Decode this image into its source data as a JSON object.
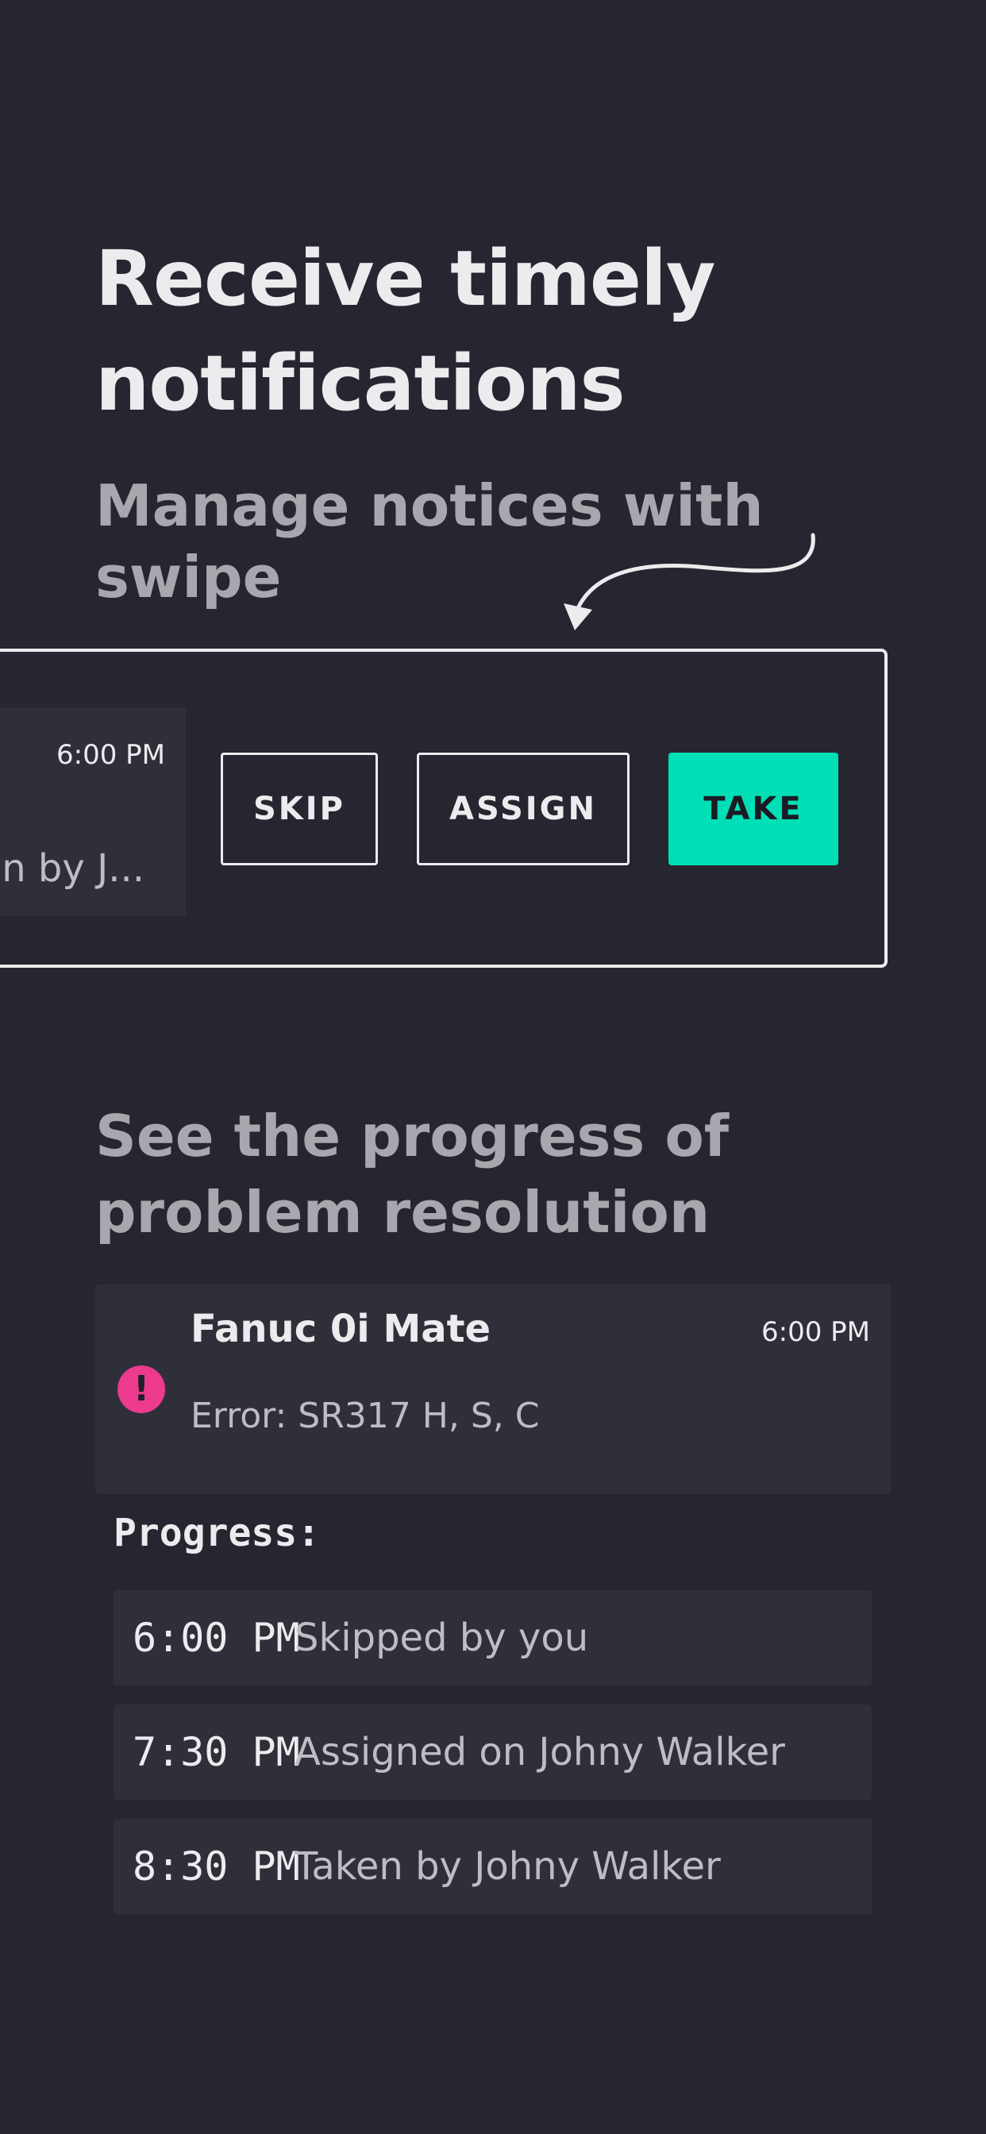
{
  "onboarding": {
    "headline": "Receive timely notifications",
    "subline": "Manage notices with swipe"
  },
  "swipe_demo": {
    "notice_time": "6:00 PM",
    "notice_text": "en by J...",
    "actions": {
      "skip": "SKIP",
      "assign": "ASSIGN",
      "take": "TAKE"
    },
    "take_color": "#00dfb5"
  },
  "progress_section": {
    "title": "See the progress of problem resolution",
    "incident": {
      "icon": "alert-icon",
      "icon_glyph": "!",
      "icon_color": "#ec3a8f",
      "title": "Fanuc 0i Mate",
      "time": "6:00 PM",
      "error": "Error: SR317 H, S, C"
    },
    "progress_label": "Progress:",
    "steps": [
      {
        "time": "6:00 PM",
        "text": "Skipped by you"
      },
      {
        "time": "7:30 PM",
        "text": "Assigned on Johny Walker"
      },
      {
        "time": "8:30 PM",
        "text": "Taken by Johny Walker"
      }
    ]
  },
  "colors": {
    "background": "#262631",
    "card": "#2f2f3a",
    "primary_text": "#ececee",
    "secondary_text": "#a7a7ad"
  }
}
